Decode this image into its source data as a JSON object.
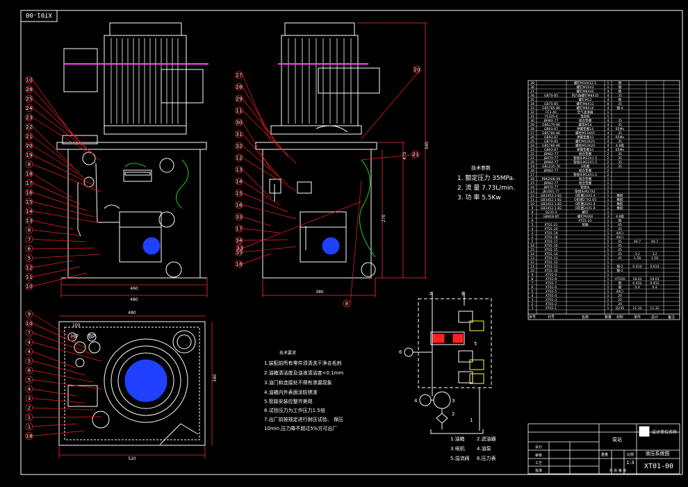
{
  "drawing_number_rotated": "XT01-00",
  "tech_params": {
    "title": "技术参数",
    "lines": [
      "1. 额定压力  35MPa.",
      "2. 流   量  7.73L/min.",
      "3. 功   率  5.5Kw"
    ]
  },
  "tech_requirements": {
    "title": "技术要求",
    "lines": [
      "1.装配前所有零件须清洗干净去毛刺",
      "2.油箱清洁度及油液清洁度<0.1mm",
      "3.油门和连接处不得有渗漏现象",
      "4.油箱内外表面涂防锈漆",
      "5.管路安装应整齐美观",
      "6.试验压力为工作压力1.5倍",
      "7.出厂前按规定进行耐压试验、 保压",
      "  10min,压力降不超过5%方可出厂"
    ]
  },
  "legend": {
    "items": [
      "1.油箱",
      "2.滤油器",
      "3.电机",
      "4.油泵",
      "5.溢流阀",
      "6.压力表"
    ]
  },
  "callouts_left": [
    "10",
    "28",
    "25",
    "24",
    "23",
    "22",
    "21",
    "20",
    "19",
    "8",
    "18",
    "17",
    "16",
    "15",
    "14",
    "13",
    "8",
    "7",
    "6",
    "5",
    "12",
    "11",
    "10"
  ],
  "callouts_center": [
    "27",
    "28",
    "29",
    "11",
    "30",
    "31",
    "32",
    "12",
    "13",
    "14",
    "15",
    "16",
    "33",
    "17",
    "34",
    "35",
    "18"
  ],
  "callouts_right": [
    "20",
    "21",
    "8",
    "33"
  ],
  "callouts_plan": [
    "9",
    "10",
    "7",
    "4",
    "4",
    "5",
    "6",
    "5",
    "4",
    "3",
    "2",
    "1",
    "1",
    "18"
  ],
  "bom_rows": [
    {
      "no": "39",
      "name": "螺钉M10X12.5",
      "qty": "1",
      "mat": "钢",
      "w1": "",
      "w2": ""
    },
    {
      "no": "38",
      "name": "螺钉M20X3",
      "qty": "1",
      "mat": "钢",
      "w1": "",
      "w2": ""
    },
    {
      "no": "37",
      "name": "螺钉M8X40",
      "qty": "4",
      "mat": "钢",
      "w1": "",
      "w2": ""
    },
    {
      "no": "36",
      "code": "GB70-85",
      "name": "内六角螺钉M8X35",
      "qty": "4",
      "mat": "35",
      "w1": "",
      "w2": ""
    },
    {
      "no": "35",
      "name": "螺钉M12",
      "qty": "4",
      "mat": "钢",
      "w1": "",
      "w2": ""
    },
    {
      "no": "34",
      "code": "GB75-85",
      "name": "螺钉M6X12",
      "qty": "8",
      "mat": "35",
      "w1": "",
      "w2": ""
    },
    {
      "no": "33",
      "code": "GB5785-86",
      "name": "螺钉M8X16",
      "qty": "4",
      "mat": "钢-4",
      "w1": "",
      "w2": ""
    },
    {
      "no": "32",
      "code": "FF3-40",
      "name": "空气滤清器",
      "qty": "1",
      "mat": "",
      "w1": "",
      "w2": ""
    },
    {
      "no": "31",
      "code": "Y132S-4",
      "name": "电动机",
      "qty": "1",
      "mat": "",
      "w1": "",
      "w2": ""
    },
    {
      "no": "30",
      "code": "JB982-77",
      "name": "组合垫圈",
      "qty": "4",
      "mat": "35",
      "w1": "",
      "w2": ""
    },
    {
      "no": "29",
      "code": "GB6170-86",
      "name": "螺母M14",
      "qty": "4",
      "mat": "35",
      "w1": "",
      "w2": ""
    },
    {
      "no": "28",
      "code": "GB93-87",
      "name": "弹簧垫圈14",
      "qty": "4",
      "mat": "65Mn",
      "w1": "",
      "w2": ""
    },
    {
      "no": "27",
      "code": "GB5780-86",
      "name": "螺栓M14X65",
      "qty": "4",
      "mat": "35",
      "w1": "",
      "w2": ""
    },
    {
      "no": "26",
      "code": "GB93-87",
      "name": "弹簧垫圈10",
      "qty": "4",
      "mat": "65Mn",
      "w1": "",
      "w2": ""
    },
    {
      "no": "25",
      "code": "GB70-85",
      "name": "螺钉M10X25",
      "qty": "4",
      "mat": "35",
      "w1": "",
      "w2": ""
    },
    {
      "no": "24",
      "code": "GB5780-86",
      "name": "螺栓M10X20",
      "qty": "4",
      "mat": "4.8级",
      "w1": "",
      "w2": ""
    },
    {
      "no": "23",
      "code": "GB93-87",
      "name": "弹簧垫圈10",
      "qty": "4",
      "mat": "65Mn",
      "w1": "",
      "w2": ""
    },
    {
      "no": "22",
      "code": "JB982-77",
      "name": "组合垫圈",
      "qty": "2",
      "mat": "35",
      "w1": "",
      "w2": ""
    },
    {
      "no": "21",
      "code": "JB970-77",
      "name": "管接头M22X1.5",
      "qty": "2",
      "mat": "35",
      "w1": "",
      "w2": ""
    },
    {
      "no": "20",
      "code": "JB984-77",
      "name": "管接头M22X1.5",
      "qty": "2",
      "mat": "35",
      "w1": "",
      "w2": ""
    },
    {
      "no": "19",
      "code": "GB1235-76",
      "name": "O形圈",
      "qty": "2",
      "mat": "35",
      "w1": "",
      "w2": ""
    },
    {
      "no": "18",
      "code": "JB982-77",
      "name": "组合垫圈",
      "qty": "2",
      "mat": "",
      "w1": "",
      "w2": ""
    },
    {
      "no": "17",
      "code": "",
      "name": "管接头M14X1.5",
      "qty": "2",
      "mat": "",
      "w1": "",
      "w2": ""
    },
    {
      "no": "16",
      "code": "PBK20/B.06",
      "name": "组合垫圈",
      "qty": "1",
      "mat": "",
      "w1": "",
      "w2": ""
    },
    {
      "no": "15",
      "code": "JB982-77",
      "name": "组合垫圈",
      "qty": "1",
      "mat": "",
      "w1": "",
      "w2": ""
    },
    {
      "no": "14",
      "code": "JB970-77",
      "name": "管接头",
      "qty": "1",
      "mat": "",
      "w1": "",
      "w2": ""
    },
    {
      "no": "13",
      "code": "JB1001-77",
      "name": "管接头M27X2",
      "qty": "1",
      "mat": "",
      "w1": "",
      "w2": ""
    },
    {
      "no": "12",
      "code": "GB3452.1-82",
      "name": "O形圈24X2.4",
      "qty": "1",
      "mat": "橡胶",
      "w1": "",
      "w2": ""
    },
    {
      "no": "11",
      "code": "GB3452.1-82",
      "name": "O形圈27X2.65",
      "qty": "1",
      "mat": "橡胶",
      "w1": "",
      "w2": ""
    },
    {
      "no": "10",
      "code": "GB3452.1-82",
      "name": "O形圈20X1.8",
      "qty": "1",
      "mat": "橡胶",
      "w1": "",
      "w2": ""
    },
    {
      "no": "9",
      "code": "GB3452.1-82",
      "name": "O形圈24X1.8",
      "qty": "1",
      "mat": "橡胶",
      "w1": "",
      "w2": ""
    },
    {
      "no": "8",
      "code": "Q235-3",
      "name": "螺钉",
      "qty": "1",
      "mat": "",
      "w1": "",
      "w2": ""
    },
    {
      "no": "7",
      "code": "GB818-85",
      "name": "螺钉M4X8",
      "qty": "3",
      "mat": "4.8级",
      "w1": "",
      "w2": ""
    },
    {
      "no": "6",
      "code": "",
      "name": "XT01-22",
      "qty": "1",
      "mat": "钢",
      "w1": "",
      "w2": ""
    },
    {
      "no": "5",
      "code": "XT01-21",
      "name": "管路",
      "qty": "1",
      "mat": "45",
      "w1": "",
      "w2": ""
    },
    {
      "no": "4",
      "code": "XT01-20",
      "name": "",
      "qty": "1",
      "mat": "45",
      "w1": "",
      "w2": ""
    },
    {
      "no": "3",
      "code": "XT01-19",
      "name": "",
      "qty": "1",
      "mat": "40Cr",
      "w1": "",
      "w2": ""
    },
    {
      "no": "2",
      "code": "XT01-18",
      "name": "",
      "qty": "1",
      "mat": "40Cr",
      "w1": "",
      "w2": ""
    },
    {
      "no": "1",
      "code": "XT01-17",
      "name": "",
      "qty": "1",
      "mat": "45",
      "w1": "44.7",
      "w2": "44.7"
    }
  ],
  "bom_rows_lower": [
    {
      "no": "16",
      "code": "XT01-16",
      "qty": "1",
      "mat": "45",
      "w1": "",
      "w2": ""
    },
    {
      "no": "15",
      "code": "XT01-15",
      "qty": "1",
      "mat": "45",
      "w1": "",
      "w2": ""
    },
    {
      "no": "14",
      "code": "XT01-14",
      "qty": "1",
      "mat": "45",
      "w1": "3.2",
      "w2": "3.2"
    },
    {
      "no": "13",
      "code": "XT01-13",
      "qty": "1",
      "mat": "45",
      "w1": "1.59",
      "w2": "1.59"
    },
    {
      "no": "12",
      "code": "XT01-12",
      "qty": "1",
      "mat": "",
      "w1": "",
      "w2": ""
    },
    {
      "no": "11",
      "code": "XT01-11",
      "qty": "1",
      "mat": "钢-2",
      "w1": "0.014",
      "w2": "0.014"
    },
    {
      "no": "10",
      "code": "XT01-10",
      "qty": "1",
      "mat": "钢-2",
      "w1": "",
      "w2": ""
    },
    {
      "no": "9",
      "code": "XT01-9",
      "qty": "1",
      "mat": "",
      "w1": "",
      "w2": ""
    },
    {
      "no": "8",
      "code": "XT01-8",
      "qty": "1",
      "mat": "HT200",
      "w1": "18.63",
      "w2": "18.63"
    },
    {
      "no": "7",
      "code": "XT01-7",
      "qty": "1",
      "mat": "钢",
      "w1": "0.452",
      "w2": "0.452"
    },
    {
      "no": "6",
      "code": "XT01-6",
      "qty": "1",
      "mat": "钢",
      "w1": "0.4",
      "w2": "0.4"
    },
    {
      "no": "5",
      "code": "XT01-5",
      "qty": "1",
      "mat": "40Cr",
      "w1": "",
      "w2": ""
    },
    {
      "no": "4",
      "code": "XT01-4",
      "qty": "1",
      "mat": "20",
      "w1": "",
      "w2": ""
    },
    {
      "no": "3",
      "code": "XT01-3",
      "qty": "1",
      "mat": "20",
      "w1": "",
      "w2": ""
    },
    {
      "no": "2",
      "code": "XT01-2",
      "qty": "1",
      "mat": "20",
      "w1": "",
      "w2": ""
    },
    {
      "no": "1",
      "code": "XT01-1",
      "qty": "1",
      "mat": "Q235",
      "w1": "11.32",
      "w2": "11.32"
    }
  ],
  "bom_header": [
    "序号",
    "代号",
    "名称",
    "数量",
    "材料",
    "单件",
    "总计",
    "备注"
  ],
  "title_block": {
    "part_name": "泵站",
    "drawing_title": "液压系统图",
    "company": "设计单位名称",
    "scale_label": "比例",
    "scale": "1:3",
    "sheet": "共 张 第 张",
    "drawing_no": "XT01-00",
    "label_designer": "设计",
    "label_checker": "审核",
    "label_process": "工艺",
    "label_approve": "批准",
    "weight_label": "重量"
  },
  "schematic_labels": [
    "A",
    "B",
    "6",
    "5",
    "4",
    "3",
    "2",
    "1"
  ],
  "dims": {
    "front_w": "460",
    "front_w2": "480",
    "side_w": "380",
    "height": "545",
    "height2": "475",
    "height3": "270",
    "plan_w": "520",
    "plan_w2": "480",
    "plan_h": "340",
    "plan_top": "100",
    "gauge_hp": "HP",
    "gauge_bp": "BP"
  },
  "colors": {
    "background": "#000000",
    "outline": "#ffffff",
    "leader": "#ff2020",
    "dim": "#ff3030",
    "green": "#20d020",
    "cyan": "#00ffff",
    "magenta": "#ff40ff",
    "yellow": "#ffff40",
    "blue": "#2040ff"
  }
}
